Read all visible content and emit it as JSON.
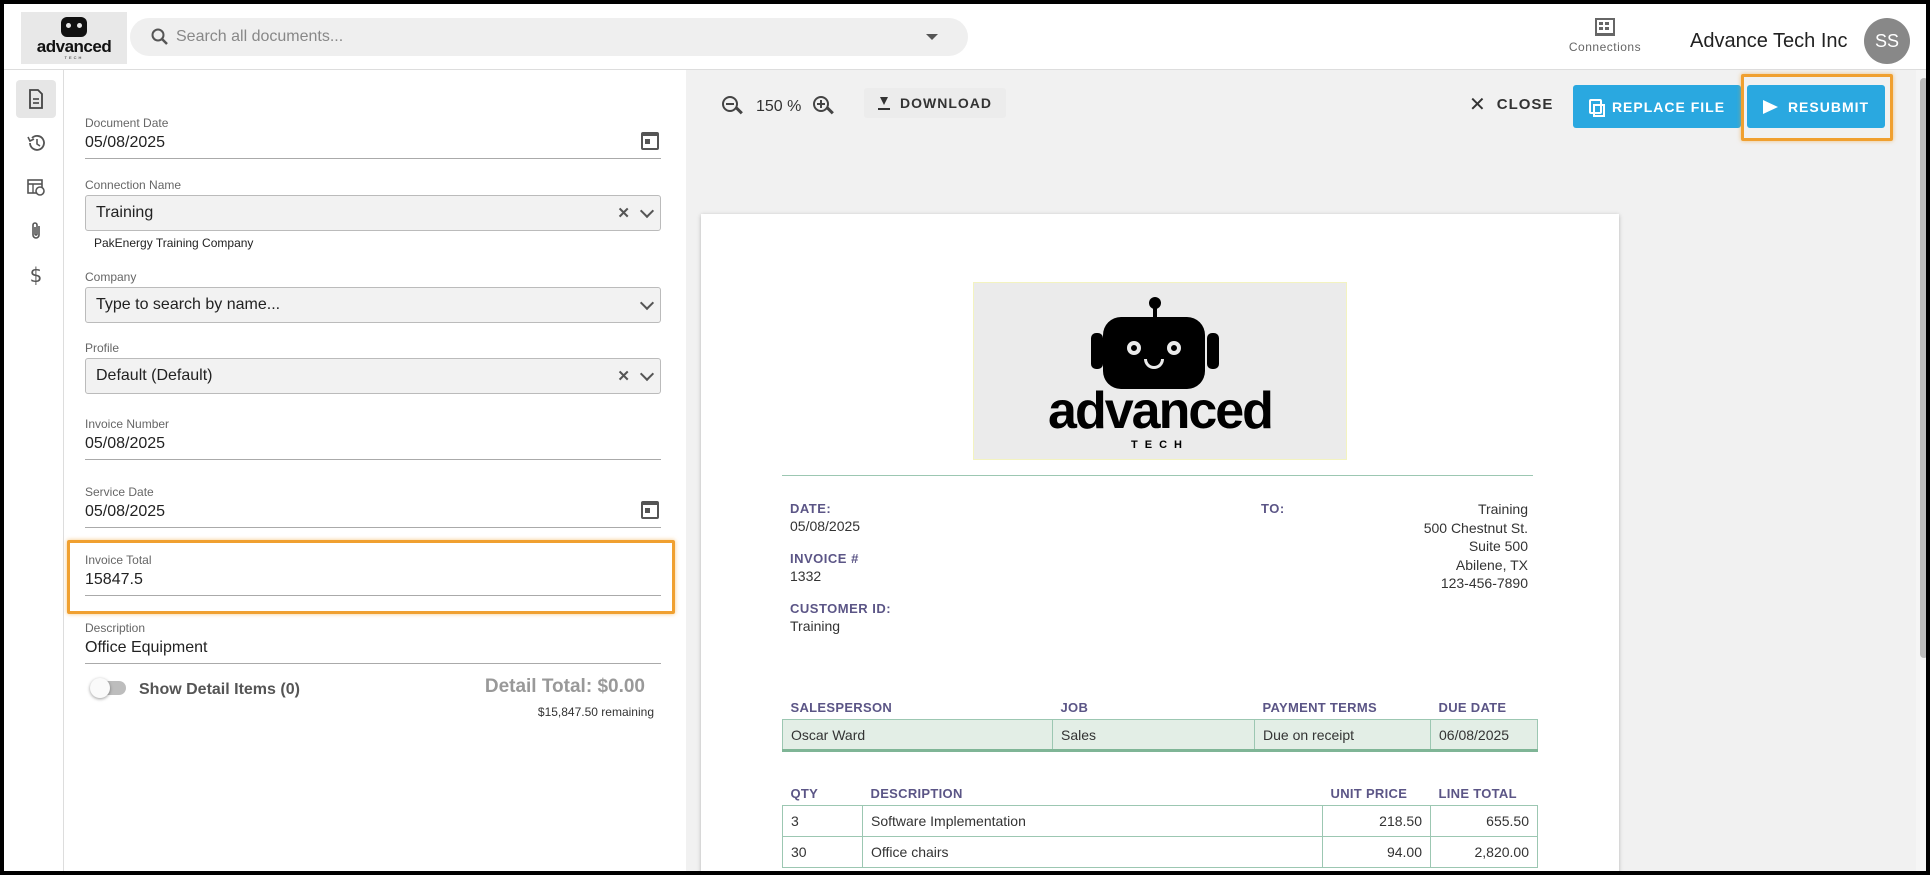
{
  "header": {
    "logo_word": "advanced",
    "logo_sub": "TECH",
    "search_placeholder": "Search all documents...",
    "connections_label": "Connections",
    "org_name": "Advance Tech Inc",
    "avatar_initials": "SS"
  },
  "rail": {
    "items": [
      "document-icon",
      "history-icon",
      "table-clock-icon",
      "paperclip-icon",
      "dollar-icon"
    ]
  },
  "form": {
    "document_date": {
      "label": "Document Date",
      "value": "05/08/2025"
    },
    "connection_name": {
      "label": "Connection Name",
      "value": "Training",
      "hint": "PakEnergy Training Company"
    },
    "company": {
      "label": "Company",
      "value": "Type to search by name..."
    },
    "profile": {
      "label": "Profile",
      "value": "Default (Default)"
    },
    "invoice_number": {
      "label": "Invoice Number",
      "value": "05/08/2025"
    },
    "service_date": {
      "label": "Service Date",
      "value": "05/08/2025"
    },
    "invoice_total": {
      "label": "Invoice Total",
      "value": "15847.5"
    },
    "description": {
      "label": "Description",
      "value": "Office Equipment"
    },
    "show_detail_label": "Show Detail Items (0)",
    "detail_total": "Detail Total: $0.00",
    "remaining": "$15,847.50 remaining"
  },
  "viewer": {
    "zoom_level": "150 %",
    "download_label": "DOWNLOAD",
    "close_label": "CLOSE",
    "replace_label": "REPLACE FILE",
    "resubmit_label": "RESUBMIT"
  },
  "invoice": {
    "logo_word": "advanced",
    "logo_sub": "TECH",
    "date_label": "DATE:",
    "date_value": "05/08/2025",
    "invoice_no_label": "INVOICE #",
    "invoice_no_value": "1332",
    "customer_label": "CUSTOMER ID:",
    "customer_value": "Training",
    "to_label": "TO:",
    "to_lines": [
      "Training",
      "500 Chestnut St.",
      "Suite 500",
      "Abilene, TX",
      "123-456-7890"
    ],
    "terms_headers": [
      "SALESPERSON",
      "JOB",
      "PAYMENT TERMS",
      "DUE DATE"
    ],
    "terms_row": [
      "Oscar Ward",
      "Sales",
      "Due on receipt",
      "06/08/2025"
    ],
    "items_headers": [
      "QTY",
      "DESCRIPTION",
      "UNIT PRICE",
      "LINE TOTAL"
    ],
    "items": [
      [
        "3",
        "Software Implementation",
        "218.50",
        "655.50"
      ],
      [
        "30",
        "Office chairs",
        "94.00",
        "2,820.00"
      ]
    ]
  }
}
